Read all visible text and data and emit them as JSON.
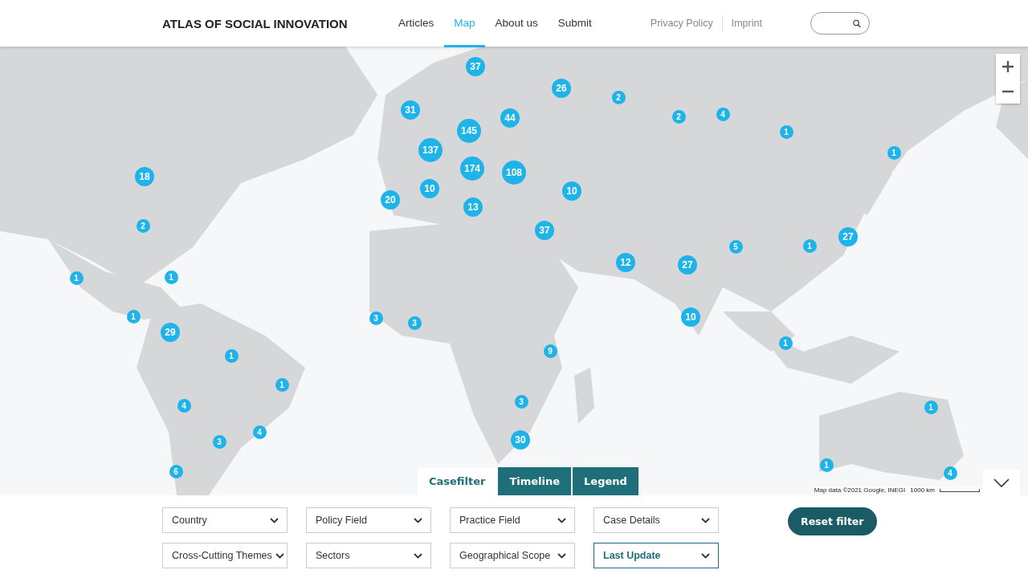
{
  "header": {
    "logo": "ATLAS OF SOCIAL INNOVATION",
    "nav": [
      {
        "label": "Articles",
        "selected": false
      },
      {
        "label": "Map",
        "selected": true
      },
      {
        "label": "About us",
        "selected": false
      },
      {
        "label": "Submit",
        "selected": false
      }
    ],
    "secondary_links": [
      "Privacy Policy",
      "Imprint"
    ]
  },
  "map": {
    "kind": "picture",
    "markers": [
      "37",
      "26",
      "2",
      "31",
      "44",
      "145",
      "2",
      "4",
      "1",
      "137",
      "1",
      "18",
      "174",
      "108",
      "10",
      "10",
      "20",
      "13",
      "2",
      "37",
      "27",
      "5",
      "1",
      "12",
      "27",
      "1",
      "1",
      "1",
      "3",
      "3",
      "10",
      "29",
      "1",
      "9",
      "1",
      "1",
      "4",
      "3",
      "1",
      "4",
      "3",
      "30",
      "6",
      "1",
      "4"
    ],
    "attribution": "Map data ©2021 Google, INEGI",
    "scale": "1000 km"
  },
  "panel_tabs": [
    {
      "label": "Casefilter",
      "selected": true
    },
    {
      "label": "Timeline",
      "selected": false
    },
    {
      "label": "Legend",
      "selected": false
    }
  ],
  "filters": [
    {
      "label": "Country",
      "selected": false
    },
    {
      "label": "Policy Field",
      "selected": false
    },
    {
      "label": "Practice Field",
      "selected": false
    },
    {
      "label": "Case Details",
      "selected": false
    },
    {
      "label": "Cross-Cutting Themes",
      "selected": false
    },
    {
      "label": "Sectors",
      "selected": false
    },
    {
      "label": "Geographical Scope",
      "selected": false
    },
    {
      "label": "Last Update",
      "selected": true
    }
  ],
  "reset_button": "Reset filter"
}
